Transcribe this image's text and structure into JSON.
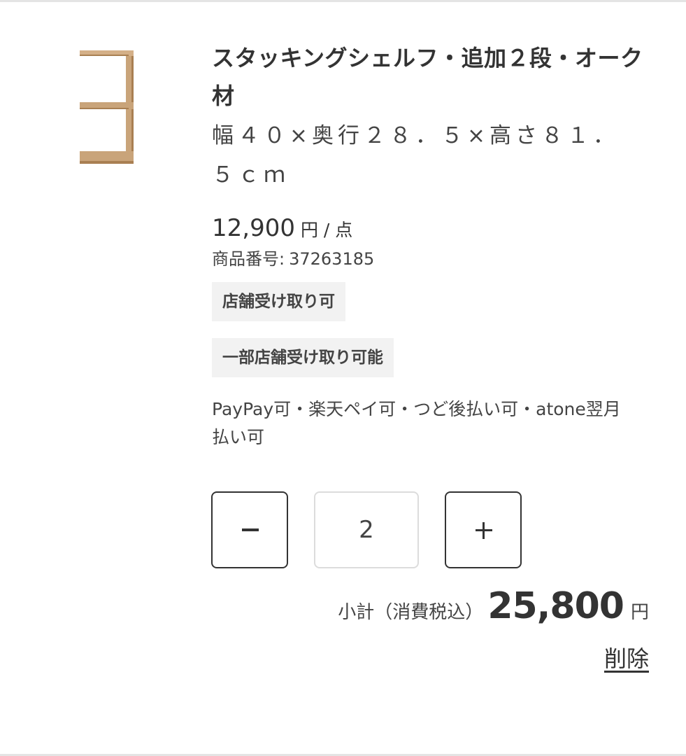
{
  "product": {
    "image_alt": "stacking-shelf-image",
    "title": "スタッキングシェルフ・追加２段・オーク材",
    "spec": "幅４０×奥行２８．５×高さ８１．５ｃｍ",
    "price": "12,900",
    "price_unit": "円 / 点",
    "sku_label": "商品番号:",
    "sku_value": "37263185",
    "badges": [
      "店舗受け取り可",
      "一部店舗受け取り可能"
    ],
    "payment": "PayPay可・楽天ペイ可・つど後払い可・atone翌月払い可"
  },
  "quantity": {
    "value": "2",
    "decrement_icon": "minus-icon",
    "increment_icon": "plus-icon"
  },
  "subtotal": {
    "label": "小計（消費税込）",
    "amount": "25,800",
    "currency": "円"
  },
  "actions": {
    "delete_label": "削除"
  },
  "colors": {
    "wood": "#c9a47a",
    "wood_edge": "#a97f52",
    "badge_bg": "#f2f2f2",
    "border_dark": "#333333"
  }
}
